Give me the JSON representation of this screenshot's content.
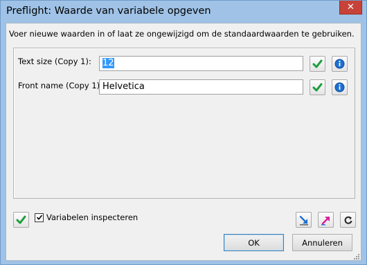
{
  "window": {
    "title": "Preflight: Waarde van variabele opgeven",
    "close_glyph": "✕"
  },
  "instruction": "Voer nieuwe waarden in of laat ze ongewijzigd om de standaardwaarden te gebruiken.",
  "variables": [
    {
      "label": "Text size (Copy 1):",
      "value": "12",
      "value_selected": true
    },
    {
      "label": "Front name (Copy 1):",
      "value": "Helvetica",
      "value_selected": false
    }
  ],
  "icons": {
    "apply": "green-checkmark-icon",
    "info": "blue-info-icon",
    "import": "blue-arrow-down-right-icon",
    "export": "magenta-arrow-up-right-icon",
    "reset": "circular-arrow-icon"
  },
  "footer": {
    "inspect_checkbox_label": "Variabelen inspecteren",
    "inspect_checked": true,
    "ok_label": "OK",
    "cancel_label": "Annuleren"
  },
  "colors": {
    "title_bar": "#9fc2e6",
    "close_button": "#c7433a",
    "check_green": "#1a9e3a",
    "info_blue": "#1e6fd0",
    "selection": "#3399ff"
  }
}
